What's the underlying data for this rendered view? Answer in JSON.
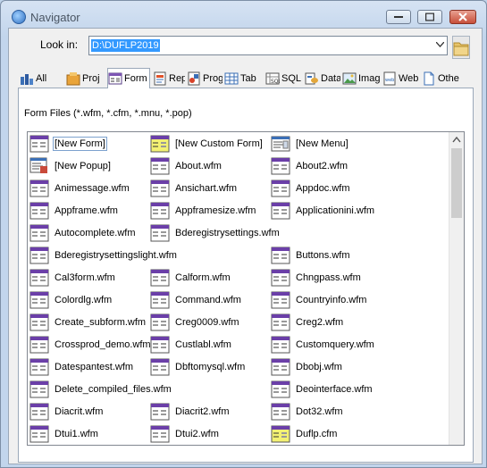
{
  "window": {
    "title": "Navigator"
  },
  "lookin": {
    "label": "Look in:",
    "value": "D:\\DUFLP2019"
  },
  "tabs": [
    {
      "label": "All",
      "icon": "all-icon"
    },
    {
      "label": "Proj",
      "icon": "project-icon"
    },
    {
      "label": "Form",
      "icon": "form-icon"
    },
    {
      "label": "Rep",
      "icon": "report-icon"
    },
    {
      "label": "Prog",
      "icon": "program-icon"
    },
    {
      "label": "Tab",
      "icon": "table-icon"
    },
    {
      "label": "SQL",
      "icon": "sql-icon"
    },
    {
      "label": "Data",
      "icon": "datamodule-icon"
    },
    {
      "label": "Imag",
      "icon": "image-icon"
    },
    {
      "label": "Web",
      "icon": "web-icon"
    },
    {
      "label": "Othe",
      "icon": "other-icon"
    }
  ],
  "filter": "Form Files (*.wfm, *.cfm, *.mnu, *.pop)",
  "files": [
    [
      {
        "name": "[New Form]",
        "icon": "new-form-icon"
      },
      {
        "name": "[New Popup]",
        "icon": "new-popup-icon"
      },
      {
        "name": "Animessage.wfm",
        "icon": "form-file-icon"
      },
      {
        "name": "Appframe.wfm",
        "icon": "form-file-icon"
      },
      {
        "name": "Autocomplete.wfm",
        "icon": "form-file-icon"
      },
      {
        "name": "Bderegistrysettingslight.wfm",
        "icon": "form-file-icon"
      },
      {
        "name": "Cal3form.wfm",
        "icon": "form-file-icon"
      },
      {
        "name": "Colordlg.wfm",
        "icon": "form-file-icon"
      },
      {
        "name": "Create_subform.wfm",
        "icon": "form-file-icon"
      },
      {
        "name": "Crossprod_demo.wfm",
        "icon": "form-file-icon"
      },
      {
        "name": "Datespantest.wfm",
        "icon": "form-file-icon"
      },
      {
        "name": "Delete_compiled_files.wfm",
        "icon": "form-file-icon"
      },
      {
        "name": "Diacrit.wfm",
        "icon": "form-file-icon"
      },
      {
        "name": "Dtui1.wfm",
        "icon": "form-file-icon"
      }
    ],
    [
      {
        "name": "[New Custom Form]",
        "icon": "new-custom-form-icon"
      },
      {
        "name": "About.wfm",
        "icon": "form-file-icon"
      },
      {
        "name": "Ansichart.wfm",
        "icon": "form-file-icon"
      },
      {
        "name": "Appframesize.wfm",
        "icon": "form-file-icon"
      },
      {
        "name": "Bderegistrysettings.wfm",
        "icon": "form-file-icon"
      },
      null,
      {
        "name": "Calform.wfm",
        "icon": "form-file-icon"
      },
      {
        "name": "Command.wfm",
        "icon": "form-file-icon"
      },
      {
        "name": "Creg0009.wfm",
        "icon": "form-file-icon"
      },
      {
        "name": "Custlabl.wfm",
        "icon": "form-file-icon"
      },
      {
        "name": "Dbftomysql.wfm",
        "icon": "form-file-icon"
      },
      null,
      {
        "name": "Diacrit2.wfm",
        "icon": "form-file-icon"
      },
      {
        "name": "Dtui2.wfm",
        "icon": "form-file-icon"
      }
    ],
    [
      {
        "name": "[New Menu]",
        "icon": "new-menu-icon"
      },
      {
        "name": "About2.wfm",
        "icon": "form-file-icon"
      },
      {
        "name": "Appdoc.wfm",
        "icon": "form-file-icon"
      },
      {
        "name": "Applicationini.wfm",
        "icon": "form-file-icon"
      },
      null,
      {
        "name": "Buttons.wfm",
        "icon": "form-file-icon"
      },
      {
        "name": "Chngpass.wfm",
        "icon": "form-file-icon"
      },
      {
        "name": "Countryinfo.wfm",
        "icon": "form-file-icon"
      },
      {
        "name": "Creg2.wfm",
        "icon": "form-file-icon"
      },
      {
        "name": "Customquery.wfm",
        "icon": "form-file-icon"
      },
      {
        "name": "Dbobj.wfm",
        "icon": "form-file-icon"
      },
      {
        "name": "Deointerface.wfm",
        "icon": "form-file-icon"
      },
      {
        "name": "Dot32.wfm",
        "icon": "form-file-icon"
      },
      {
        "name": "Duflp.cfm",
        "icon": "custom-form-file-icon"
      }
    ]
  ]
}
